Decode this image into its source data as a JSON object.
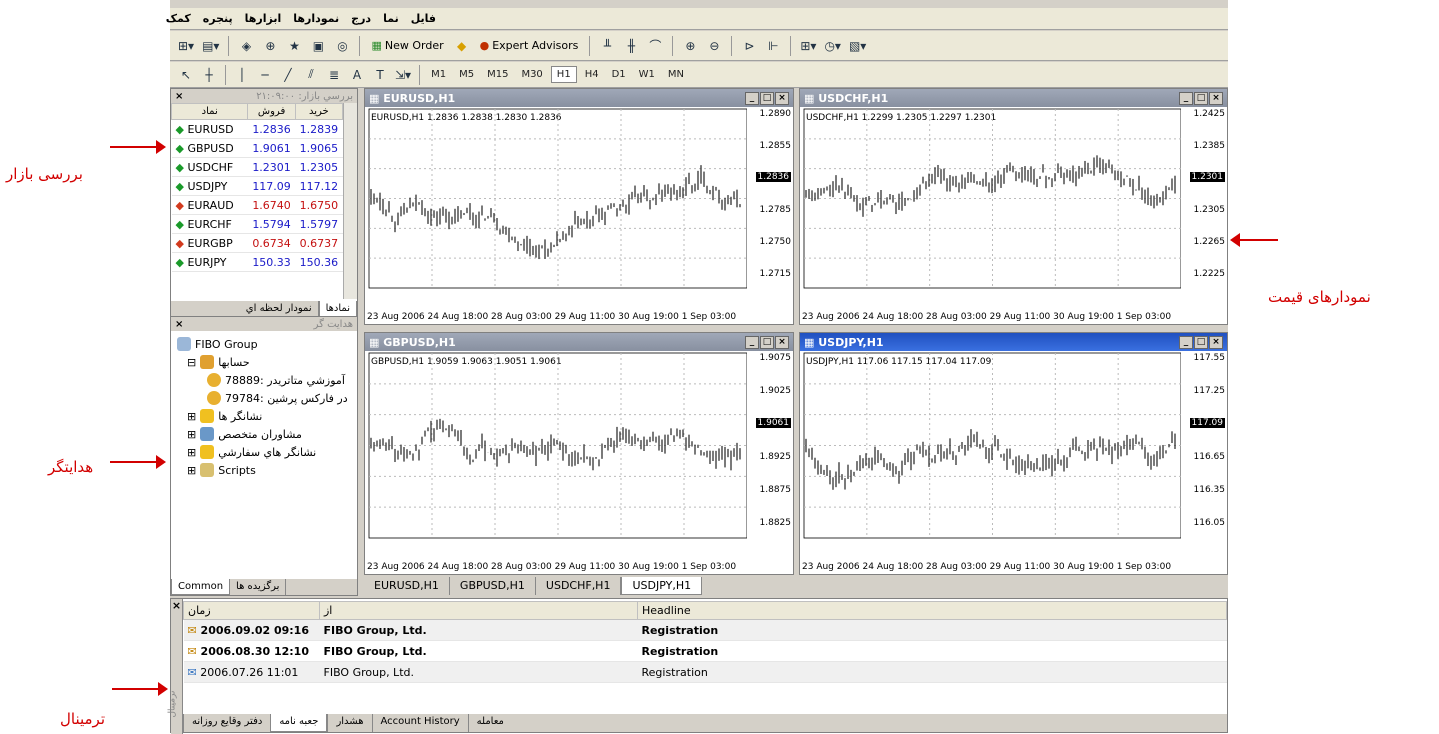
{
  "menu": [
    "فایل",
    "نما",
    "درج",
    "نمودارها",
    "ابزارها",
    "پنجره",
    "کمک"
  ],
  "toolbar": {
    "new_order": "New Order",
    "expert_advisors": "Expert Advisors",
    "timeframes": [
      "M1",
      "M5",
      "M15",
      "M30",
      "H1",
      "H4",
      "D1",
      "W1",
      "MN"
    ],
    "active_tf": "H1"
  },
  "market_watch": {
    "title": "بررسي بازار: ۲۱:۰۹:۰۰",
    "col_symbol": "نماد",
    "col_bid": "فروش",
    "col_ask": "خريد",
    "rows": [
      {
        "sym": "EURUSD",
        "bid": "1.2836",
        "ask": "1.2839",
        "dir": "up"
      },
      {
        "sym": "GBPUSD",
        "bid": "1.9061",
        "ask": "1.9065",
        "dir": "up"
      },
      {
        "sym": "USDCHF",
        "bid": "1.2301",
        "ask": "1.2305",
        "dir": "up"
      },
      {
        "sym": "USDJPY",
        "bid": "117.09",
        "ask": "117.12",
        "dir": "up"
      },
      {
        "sym": "EURAUD",
        "bid": "1.6740",
        "ask": "1.6750",
        "dir": "dn"
      },
      {
        "sym": "EURCHF",
        "bid": "1.5794",
        "ask": "1.5797",
        "dir": "up"
      },
      {
        "sym": "EURGBP",
        "bid": "0.6734",
        "ask": "0.6737",
        "dir": "dn"
      },
      {
        "sym": "EURJPY",
        "bid": "150.33",
        "ask": "150.36",
        "dir": "up"
      }
    ],
    "tab_symbols": "نمادها",
    "tab_tick": "نمودار لحظه اي"
  },
  "navigator": {
    "title": "هدایت گر",
    "root": "FIBO Group",
    "accounts": "حسابها",
    "acc1": "آموزشي متاتريدر :78889",
    "acc2": "در فارکس پرشين :79784",
    "indicators": "نشانگر ها",
    "experts": "مشاوران متخصص",
    "custom": "نشانگر هاي سفارشي",
    "scripts": "Scripts",
    "tab_common": "Common",
    "tab_fav": "برگزيده ها"
  },
  "charts": [
    {
      "title": "EURUSD,H1",
      "label": "EURUSD,H1  1.2836 1.2838 1.2830 1.2836",
      "prices": [
        "1.2890",
        "1.2855",
        "1.2820",
        "1.2785",
        "1.2750",
        "1.2715"
      ],
      "last": "1.2836"
    },
    {
      "title": "USDCHF,H1",
      "label": "USDCHF,H1  1.2299 1.2305 1.2297 1.2301",
      "prices": [
        "1.2425",
        "1.2385",
        "1.2345",
        "1.2305",
        "1.2265",
        "1.2225"
      ],
      "last": "1.2301"
    },
    {
      "title": "GBPUSD,H1",
      "label": "GBPUSD,H1  1.9059 1.9063 1.9051 1.9061",
      "prices": [
        "1.9075",
        "1.9025",
        "1.8975",
        "1.8925",
        "1.8875",
        "1.8825"
      ],
      "last": "1.9061"
    },
    {
      "title": "USDJPY,H1",
      "label": "USDJPY,H1  117.06 117.15 117.04 117.09",
      "prices": [
        "117.55",
        "117.25",
        "116.95",
        "116.65",
        "116.35",
        "116.05"
      ],
      "last": "117.09"
    }
  ],
  "x_axis": "23 Aug 2006   24 Aug 18:00   28 Aug 03:00   29 Aug 11:00   30 Aug 19:00   1 Sep 03:00",
  "chart_tabs": [
    "EURUSD,H1",
    "GBPUSD,H1",
    "USDCHF,H1",
    "USDJPY,H1"
  ],
  "terminal": {
    "col_time": "زمان",
    "col_from": "از",
    "col_headline": "Headline",
    "rows": [
      {
        "time": "2006.09.02 09:16",
        "from": "FIBO Group, Ltd.",
        "headline": "Registration"
      },
      {
        "time": "2006.08.30 12:10",
        "from": "FIBO Group, Ltd.",
        "headline": "Registration"
      },
      {
        "time": "2006.07.26 11:01",
        "from": "FIBO Group, Ltd.",
        "headline": "Registration"
      }
    ],
    "side": "ترمینال",
    "tabs": [
      "معامله",
      "Account History",
      "هشدار",
      "جعبه نامه",
      "دفتر وقايع روزانه"
    ]
  },
  "annotations": {
    "market": "بررسی بازار",
    "charts": "نمودارهای  قیمت",
    "navigator": "هدایتگر",
    "terminal": "ترمینال"
  },
  "colors": {
    "up": "#1a9a2a",
    "down": "#d23a1e",
    "annotation": "#d20000",
    "active_title": "#2050c0"
  }
}
